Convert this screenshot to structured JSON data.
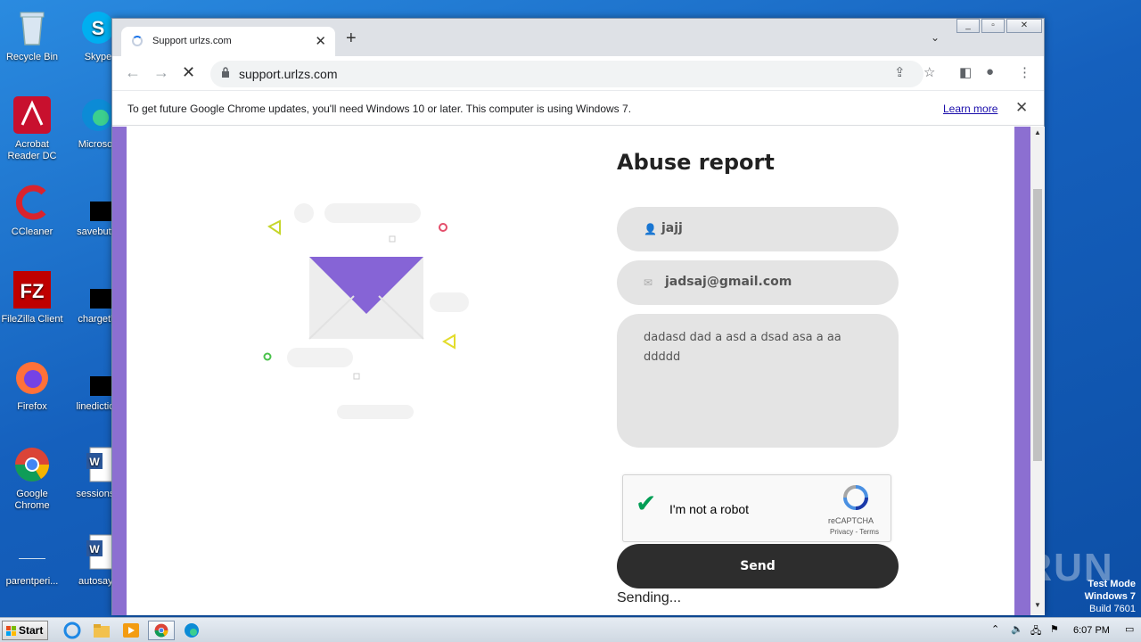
{
  "desktop": {
    "icons": [
      {
        "label": "Recycle Bin"
      },
      {
        "label": "Skype"
      },
      {
        "label": "Acrobat"
      },
      {
        "label": "Reader DC"
      },
      {
        "label": "Microsoft"
      },
      {
        "label": "CCleaner"
      },
      {
        "label": "savebutto"
      },
      {
        "label": "FileZilla Client"
      },
      {
        "label": "chargethi"
      },
      {
        "label": "Firefox"
      },
      {
        "label": "linediction"
      },
      {
        "label": "Google"
      },
      {
        "label": "Chrome"
      },
      {
        "label": "sessionsu"
      },
      {
        "label": "parentperi..."
      },
      {
        "label": "autosays"
      }
    ],
    "watermark": "ANY RUN",
    "test_mode": [
      "Test Mode",
      "Windows 7",
      "Build 7601"
    ]
  },
  "browser": {
    "tab_title": "Support urlzs.com",
    "url": "support.urlzs.com",
    "infobar_message": "To get future Google Chrome updates, you'll need Windows 10 or later. This computer is using Windows 7.",
    "infobar_link": "Learn more"
  },
  "form": {
    "heading": "Abuse report",
    "name_value": "jajj",
    "email_value": "jadsaj@gmail.com",
    "message_value": "dadasd  dad a asd a dsad asa a aa   ddddd",
    "captcha_label": "I'm not a robot",
    "captcha_brand": "reCAPTCHA",
    "captcha_terms": "Privacy - Terms",
    "send_label": "Send",
    "status": "Sending..."
  },
  "taskbar": {
    "start_label": "Start",
    "clock": "6:07 PM"
  },
  "colors": {
    "accent_purple": "#8c6fd1",
    "send_button": "#2d2d2d",
    "field_bg": "#e4e4e4"
  }
}
